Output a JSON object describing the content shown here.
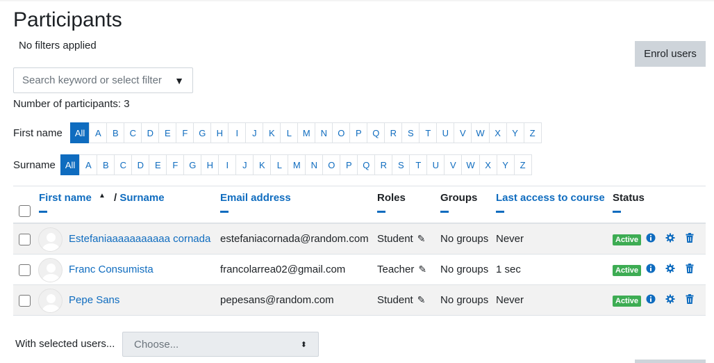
{
  "page": {
    "title": "Participants",
    "filters_text": "No filters applied",
    "enrol_button": "Enrol users"
  },
  "search": {
    "placeholder": "Search keyword or select filter",
    "caret": "▼"
  },
  "participants_count": "Number of participants: 3",
  "first_name_filter": {
    "label": "First name",
    "letters": [
      "All",
      "A",
      "B",
      "C",
      "D",
      "E",
      "F",
      "G",
      "H",
      "I",
      "J",
      "K",
      "L",
      "M",
      "N",
      "O",
      "P",
      "Q",
      "R",
      "S",
      "T",
      "U",
      "V",
      "W",
      "X",
      "Y",
      "Z"
    ],
    "active": "All"
  },
  "surname_filter": {
    "label": "Surname",
    "letters": [
      "All",
      "A",
      "B",
      "C",
      "D",
      "E",
      "F",
      "G",
      "H",
      "I",
      "J",
      "K",
      "L",
      "M",
      "N",
      "O",
      "P",
      "Q",
      "R",
      "S",
      "T",
      "U",
      "V",
      "W",
      "X",
      "Y",
      "Z"
    ],
    "active": "All"
  },
  "table": {
    "headers": {
      "first_name": "First name",
      "sort_indicator": "▲",
      "separator": "/",
      "surname": "Surname",
      "email": "Email address",
      "roles": "Roles",
      "groups": "Groups",
      "last_access": "Last access to course",
      "status": "Status"
    },
    "rows": [
      {
        "name": "Estefaniaaaaaaaaaaa cornada",
        "email": "estefaniacornada@random.com",
        "role": "Student",
        "groups": "No groups",
        "last_access": "Never",
        "status": "Active"
      },
      {
        "name": "Franc Consumista",
        "email": "francolarrea02@gmail.com",
        "role": "Teacher",
        "groups": "No groups",
        "last_access": "1 sec",
        "status": "Active"
      },
      {
        "name": "Pepe Sans",
        "email": "pepesans@random.com",
        "role": "Student",
        "groups": "No groups",
        "last_access": "Never",
        "status": "Active"
      }
    ]
  },
  "bulk": {
    "label": "With selected users...",
    "placeholder": "Choose..."
  },
  "icons": {
    "edit": "pencil-icon",
    "info": "info-icon",
    "settings": "gear-icon",
    "delete": "trash-icon",
    "avatar": "user-avatar"
  },
  "colors": {
    "link": "#0f6cbf",
    "active_badge": "#3dac53",
    "button_bg": "#ced4da"
  }
}
